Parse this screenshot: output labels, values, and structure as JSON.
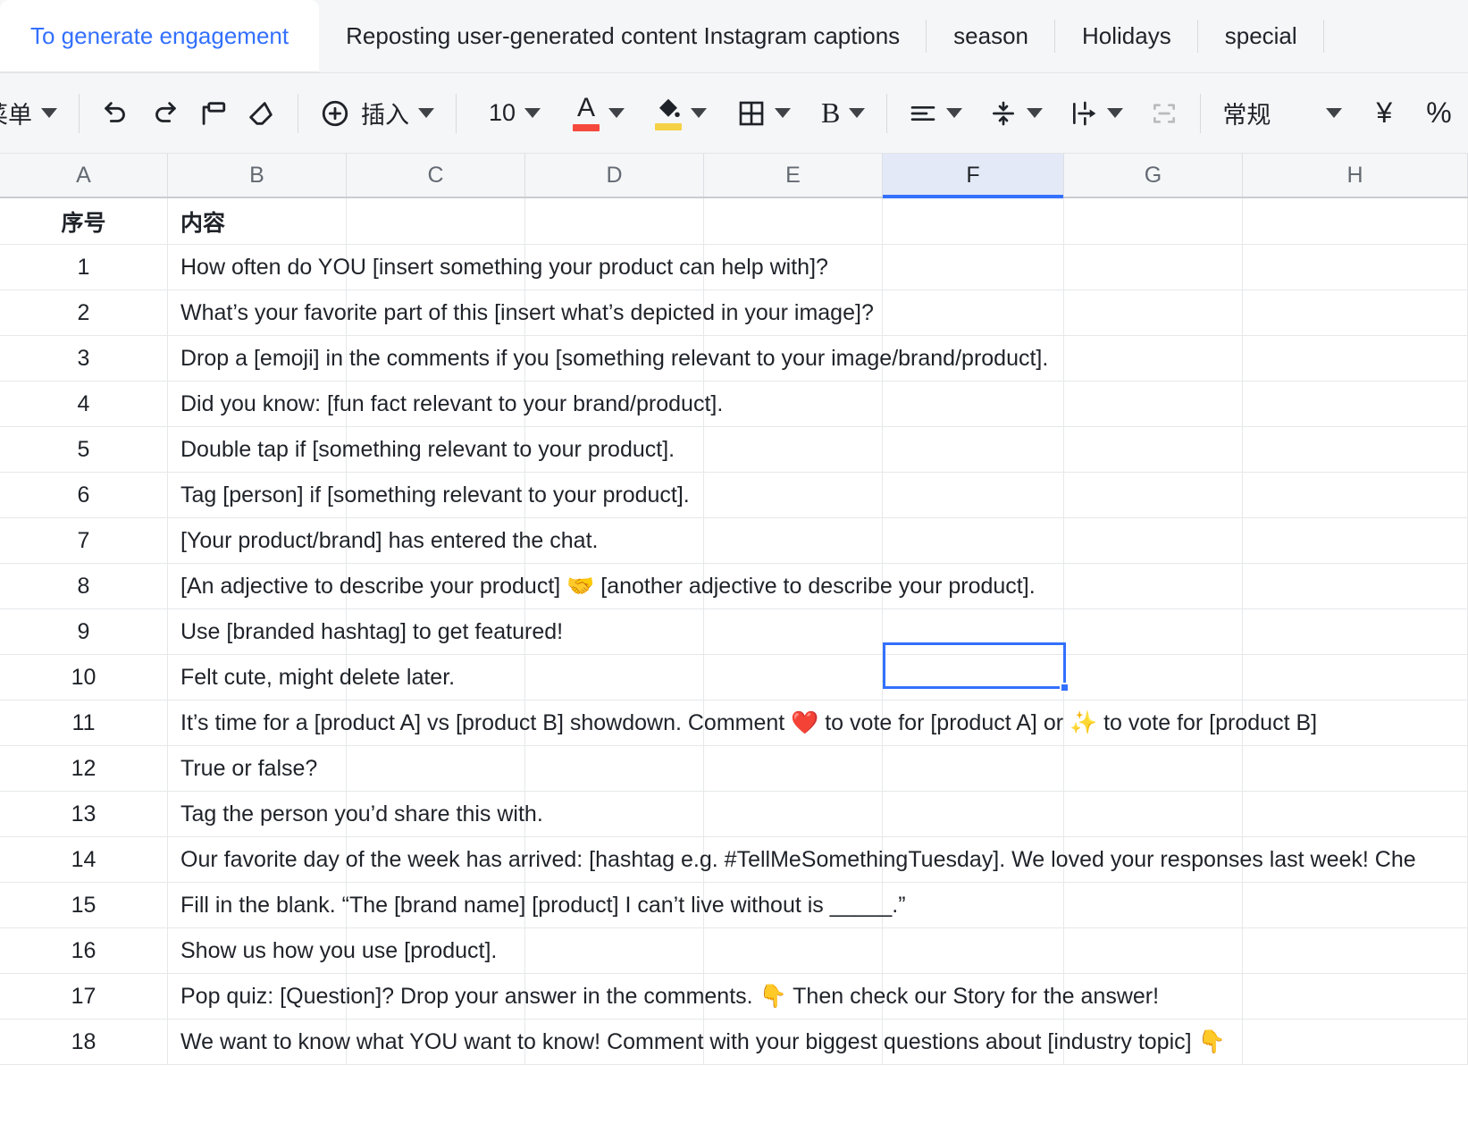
{
  "tabs": [
    {
      "label": "To generate engagement",
      "active": true
    },
    {
      "label": "Reposting user-generated content Instagram captions",
      "active": false
    },
    {
      "label": "season",
      "active": false
    },
    {
      "label": "Holidays",
      "active": false
    },
    {
      "label": "special",
      "active": false
    }
  ],
  "toolbar": {
    "menu_label": "菜单",
    "undo_label": "undo",
    "redo_label": "redo",
    "format_painter_label": "format-painter",
    "clear_format_label": "clear-format",
    "insert_label": "插入",
    "font_size": "10",
    "text_color_label": "A",
    "fill_color_label": "fill",
    "borders_label": "borders",
    "bold_label": "B",
    "align_label": "align",
    "valign_label": "vertical-align",
    "wrap_label": "wrap-text",
    "merge_label": "merge-cells",
    "number_format": "常规",
    "currency_label": "¥",
    "percent_label": "%",
    "text_color_swatch": "#f5493d",
    "fill_color_swatch": "#f5d145",
    "accent": "#3370ff"
  },
  "sheet": {
    "columns": [
      "A",
      "B",
      "C",
      "D",
      "E",
      "F",
      "G",
      "H"
    ],
    "selected_column": "F",
    "selected_cell": "F6",
    "header_row": [
      "序号",
      "内容",
      "",
      "",
      "",
      "",
      "",
      ""
    ],
    "rows": [
      {
        "num": "1",
        "content": "How often do YOU [insert something your product can help with]?"
      },
      {
        "num": "2",
        "content": "What’s your favorite part of this [insert what’s depicted in your image]?"
      },
      {
        "num": "3",
        "content": "Drop a [emoji] in the comments if you [something relevant to your image/brand/product]."
      },
      {
        "num": "4",
        "content": "Did you know: [fun fact relevant to your brand/product]."
      },
      {
        "num": "5",
        "content": "Double tap if [something relevant to your product]."
      },
      {
        "num": "6",
        "content": "Tag [person] if [something relevant to your product]."
      },
      {
        "num": "7",
        "content": "[Your product/brand] has entered the chat."
      },
      {
        "num": "8",
        "content": "[An adjective to describe your product] 🤝 [another adjective to describe your product]."
      },
      {
        "num": "9",
        "content": "Use [branded hashtag] to get featured!"
      },
      {
        "num": "10",
        "content": "Felt cute, might delete later."
      },
      {
        "num": "11",
        "content": "It’s time for a [product A] vs [product B] showdown. Comment ❤️ to vote for [product A] or ✨ to vote for [product B]"
      },
      {
        "num": "12",
        "content": "True or false?"
      },
      {
        "num": "13",
        "content": "Tag the person you’d share this with."
      },
      {
        "num": "14",
        "content": "Our favorite day of the week has arrived: [hashtag e.g. #TellMeSomethingTuesday]. We loved your responses last week! Che"
      },
      {
        "num": "15",
        "content": "Fill in the blank. “The [brand name] [product] I can’t live without is _____.”"
      },
      {
        "num": "16",
        "content": "Show us how you use [product]."
      },
      {
        "num": "17",
        "content": "Pop quiz: [Question]? Drop your answer in the comments. 👇 Then check our Story for the answer!"
      },
      {
        "num": "18",
        "content": "We want to know what YOU want to know! Comment with your biggest questions about [industry topic] 👇"
      }
    ]
  }
}
